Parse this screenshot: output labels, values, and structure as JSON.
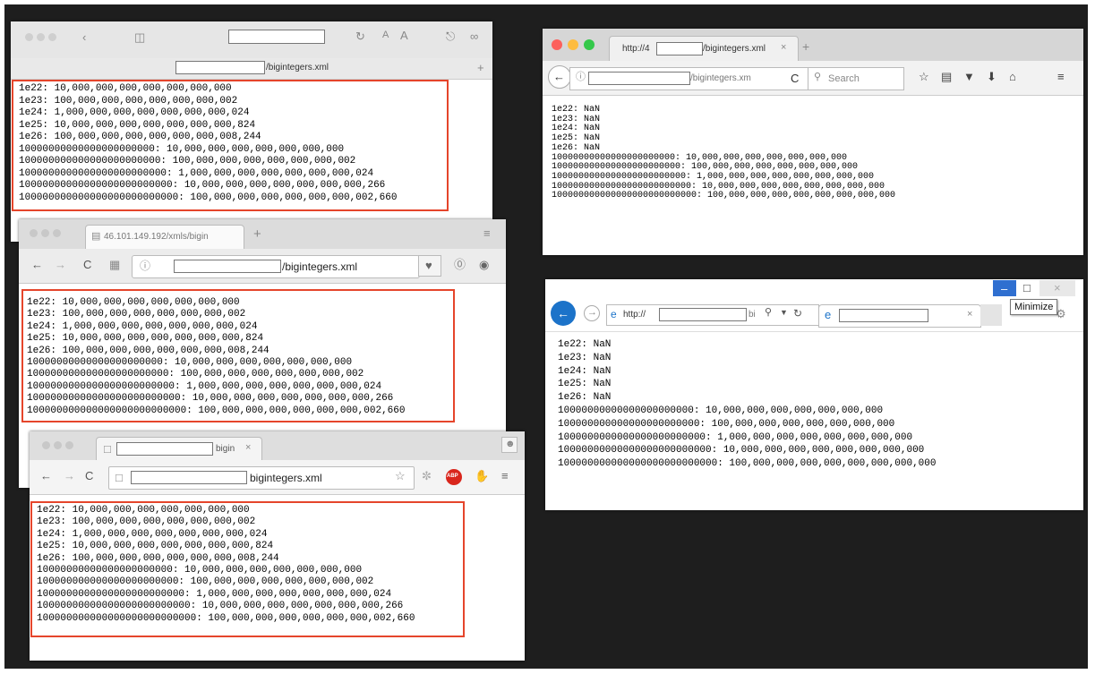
{
  "lines_main": [
    "1e22: 10,000,000,000,000,000,000,000",
    "1e23: 100,000,000,000,000,000,000,002",
    "1e24: 1,000,000,000,000,000,000,000,024",
    "1e25: 10,000,000,000,000,000,000,000,824",
    "1e26: 100,000,000,000,000,000,000,008,244",
    "10000000000000000000000: 10,000,000,000,000,000,000,000",
    "100000000000000000000000: 100,000,000,000,000,000,000,002",
    "1000000000000000000000000: 1,000,000,000,000,000,000,000,024",
    "10000000000000000000000000: 10,000,000,000,000,000,000,000,266",
    "100000000000000000000000000: 100,000,000,000,000,000,000,002,660"
  ],
  "lines_nan": [
    "1e22: NaN",
    "1e23: NaN",
    "1e24: NaN",
    "1e25: NaN",
    "1e26: NaN",
    "10000000000000000000000: 10,000,000,000,000,000,000,000",
    "100000000000000000000000: 100,000,000,000,000,000,000,000",
    "1000000000000000000000000: 1,000,000,000,000,000,000,000,000",
    "10000000000000000000000000: 10,000,000,000,000,000,000,000,000",
    "100000000000000000000000000: 100,000,000,000,000,000,000,000,000"
  ],
  "safari": {
    "url_suffix": "/bigintegers.xml"
  },
  "firefox_old": {
    "tab_title": "46.101.149.192/xmls/bigin",
    "url_suffix": "/bigintegers.xml"
  },
  "chrome": {
    "tab_title": "bigin",
    "url_suffix": "bigintegers.xml",
    "abp_label": "ABP"
  },
  "firefox_new": {
    "tab_prefix": "http://4",
    "tab_suffix": "/bigintegers.xml",
    "url_suffix": "/bigintegers.xm",
    "search_placeholder": "Search"
  },
  "ie": {
    "url_prefix": "http://",
    "url_frag": "bi",
    "tooltip": "Minimize"
  },
  "colors": {
    "highlight": "#e5452b",
    "ie_blue": "#1c73c9"
  }
}
